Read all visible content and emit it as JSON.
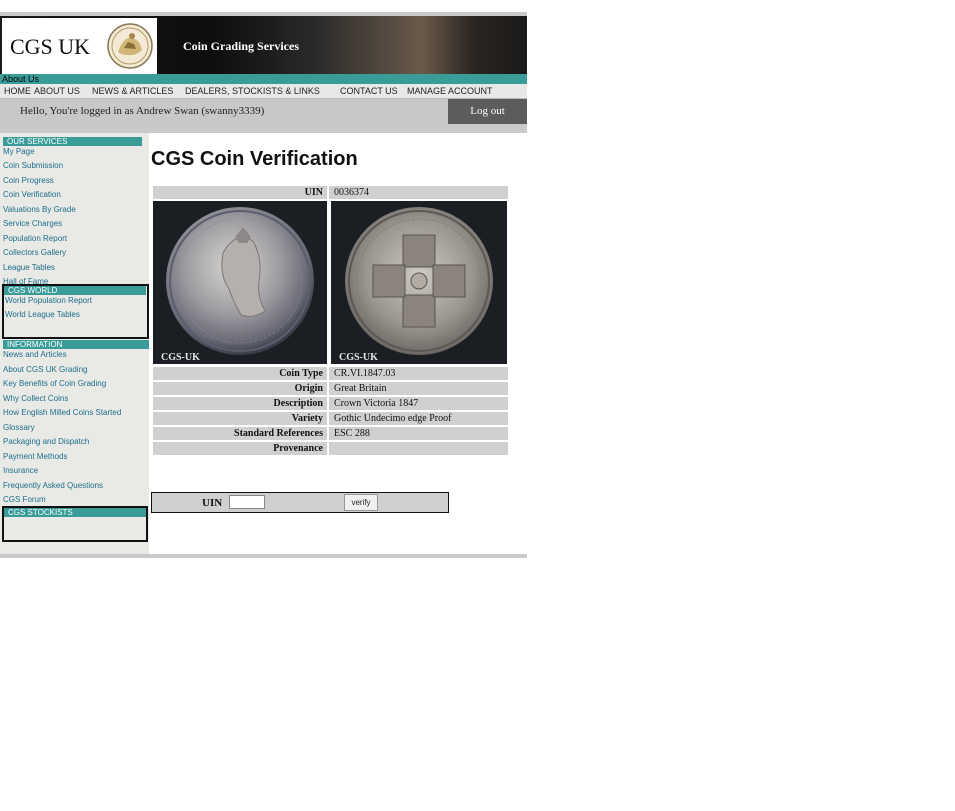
{
  "banner": {
    "logo_text": "CGS UK",
    "title": "Coin Grading Services"
  },
  "about_label": "About Us",
  "nav": {
    "items": [
      {
        "label": "HOME"
      },
      {
        "label": "ABOUT US"
      },
      {
        "label": "NEWS & ARTICLES"
      },
      {
        "label": "DEALERS, STOCKISTS & LINKS"
      },
      {
        "label": "CONTACT US"
      },
      {
        "label": "MANAGE ACCOUNT"
      }
    ]
  },
  "login": {
    "message": "Hello, You're logged in as Andrew Swan (swanny3339)",
    "logout_label": "Log out"
  },
  "sidebar": {
    "services_title": "OUR SERVICES",
    "services": [
      {
        "label": "My Page"
      },
      {
        "label": "Coin Submission"
      },
      {
        "label": "Coin Progress"
      },
      {
        "label": "Coin Verification"
      },
      {
        "label": "Valuations By Grade"
      },
      {
        "label": "Service Charges"
      },
      {
        "label": "Population Report"
      },
      {
        "label": "Collectors Gallery"
      },
      {
        "label": "League Tables"
      },
      {
        "label": "Hall of Fame"
      }
    ],
    "world_title": "CGS WORLD",
    "world": [
      {
        "label": "World Population Report"
      },
      {
        "label": "World League Tables"
      }
    ],
    "info_title": "INFORMATION",
    "info": [
      {
        "label": "News and Articles"
      },
      {
        "label": "About CGS UK Grading"
      },
      {
        "label": "Key Benefits of Coin Grading"
      },
      {
        "label": "Why Collect Coins"
      },
      {
        "label": "How English Milled Coins Started"
      },
      {
        "label": "Glossary"
      },
      {
        "label": "Packaging and Dispatch"
      },
      {
        "label": "Payment Methods"
      },
      {
        "label": "Insurance"
      },
      {
        "label": "Frequently Asked Questions"
      },
      {
        "label": "CGS Forum"
      }
    ],
    "stockists_title": "CGS STOCKISTS"
  },
  "main": {
    "page_title": "CGS Coin Verification",
    "uin_label": "UIN",
    "uin_value": "0036374",
    "images": {
      "obverse_caption": "CGS-UK",
      "reverse_caption": "CGS-UK"
    },
    "details": [
      {
        "label": "Coin Type",
        "value": "CR.VI.1847.03"
      },
      {
        "label": "Origin",
        "value": "Great Britain"
      },
      {
        "label": "Description",
        "value": "Crown Victoria 1847"
      },
      {
        "label": "Variety",
        "value": "Gothic Undecimo edge Proof"
      },
      {
        "label": "Standard References",
        "value": "ESC 288"
      },
      {
        "label": "Provenance",
        "value": ""
      }
    ]
  },
  "verify_form": {
    "uin_label": "UIN",
    "input_value": "",
    "button_label": "verify"
  },
  "colors": {
    "teal": "#3a9c99",
    "link": "#1d6f8a",
    "logout_bg": "#5c5c5c"
  }
}
